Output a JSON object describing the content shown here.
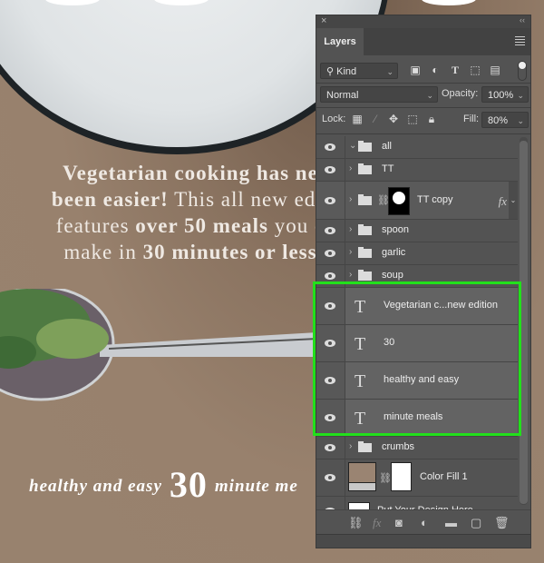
{
  "canvas": {
    "body_copy": {
      "line1_bold": "Vegetarian cooking has ne",
      "line2_bold": "been easier!",
      "line2_regular": " This all new edit",
      "line3_regular_a": "features ",
      "line3_bold": "over 50 meals",
      "line3_regular_b": " you c",
      "line4_regular": "make in ",
      "line4_bold": "30 minutes or less"
    },
    "tagline": {
      "left": "healthy and easy",
      "number": "30",
      "right": "minute me"
    },
    "background_color": "#97806c"
  },
  "panel": {
    "close_glyph": "×",
    "collapse_glyph": "‹‹",
    "tab_label": "Layers",
    "filter": {
      "label": "Kind",
      "icons": [
        "image-filter-icon",
        "adjustment-filter-icon",
        "type-filter-icon",
        "shape-filter-icon",
        "smart-object-filter-icon"
      ]
    },
    "blend_mode": "Normal",
    "opacity_label": "Opacity:",
    "opacity_value": "100%",
    "lock_label": "Lock:",
    "fill_label": "Fill:",
    "fill_value": "80%",
    "layers": [
      {
        "name": "all",
        "type": "group",
        "expanded": true
      },
      {
        "name": "TT",
        "type": "group",
        "expanded": false
      },
      {
        "name": "TT copy",
        "type": "group-masked",
        "expanded": false,
        "fx": "fx"
      },
      {
        "name": "spoon",
        "type": "group",
        "expanded": false
      },
      {
        "name": "garlic",
        "type": "group",
        "expanded": false
      },
      {
        "name": "soup",
        "type": "group",
        "expanded": false
      },
      {
        "name": "Vegetarian c...new edition",
        "type": "text"
      },
      {
        "name": "30",
        "type": "text"
      },
      {
        "name": "healthy and easy",
        "type": "text"
      },
      {
        "name": "minute meals",
        "type": "text"
      },
      {
        "name": "crumbs",
        "type": "group",
        "expanded": false
      },
      {
        "name": "Color Fill 1",
        "type": "fill",
        "fill_color": "#9a8472"
      },
      {
        "name": "Put Your Design Here",
        "type": "smart-object"
      }
    ],
    "highlight_color": "#22e01b"
  }
}
